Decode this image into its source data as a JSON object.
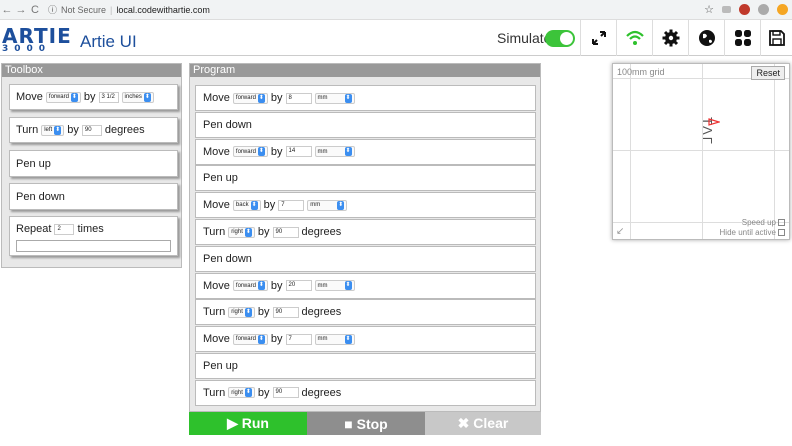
{
  "browser": {
    "back": "←",
    "forward": "→",
    "reload": "C",
    "info_icon": "ⓘ",
    "security": "Not Secure",
    "separator": "|",
    "url": "local.codewithartie.com",
    "star": "☆"
  },
  "app": {
    "logo_main": "ARTIE",
    "logo_sub": "3000",
    "title": "Artie UI",
    "simulate_label": "Simulate",
    "simulate_on": true,
    "accent": "#3cc43a",
    "brand": "#1d4f9c",
    "icons": [
      "expand-icon",
      "wifi-icon",
      "gear-icon",
      "globe-icon",
      "apps-icon",
      "save-icon"
    ]
  },
  "toolbox": {
    "title": "Toolbox",
    "move": {
      "label": "Move",
      "dir": "forward",
      "by": "by",
      "amount": "3 1/2",
      "unit": "inches"
    },
    "turn": {
      "label": "Turn",
      "dir": "left",
      "by": "by",
      "amount": "90",
      "unit": "degrees"
    },
    "pen_up": "Pen up",
    "pen_down": "Pen down",
    "repeat": {
      "label": "Repeat",
      "count": "2",
      "times": "times"
    }
  },
  "program": {
    "title": "Program",
    "by": "by",
    "steps": [
      {
        "kind": "move",
        "label": "Move",
        "dir": "forward",
        "amount": "8",
        "unit": "mm"
      },
      {
        "kind": "text",
        "label": "Pen down"
      },
      {
        "kind": "move",
        "label": "Move",
        "dir": "forward",
        "amount": "14",
        "unit": "mm"
      },
      {
        "kind": "text",
        "label": "Pen up"
      },
      {
        "kind": "move",
        "label": "Move",
        "dir": "back",
        "amount": "7",
        "unit": "mm"
      },
      {
        "kind": "turn",
        "label": "Turn",
        "dir": "right",
        "amount": "90",
        "unit": "degrees"
      },
      {
        "kind": "text",
        "label": "Pen down"
      },
      {
        "kind": "move",
        "label": "Move",
        "dir": "forward",
        "amount": "20",
        "unit": "mm"
      },
      {
        "kind": "turn",
        "label": "Turn",
        "dir": "right",
        "amount": "90",
        "unit": "degrees"
      },
      {
        "kind": "move",
        "label": "Move",
        "dir": "forward",
        "amount": "7",
        "unit": "mm"
      },
      {
        "kind": "text",
        "label": "Pen up"
      },
      {
        "kind": "turn",
        "label": "Turn",
        "dir": "right",
        "amount": "90",
        "unit": "degrees"
      }
    ]
  },
  "controls": {
    "run": "▶ Run",
    "stop": "■ Stop",
    "clear": "✖ Clear",
    "run_color": "#2ec12c",
    "stop_color": "#8e8e8e",
    "clear_color": "#c8c8c8"
  },
  "grid": {
    "label": "100mm grid",
    "reset": "Reset",
    "drawing": "ΤΛΓ",
    "speed_up": "Speed up",
    "hide_until_active": "Hide until active"
  }
}
